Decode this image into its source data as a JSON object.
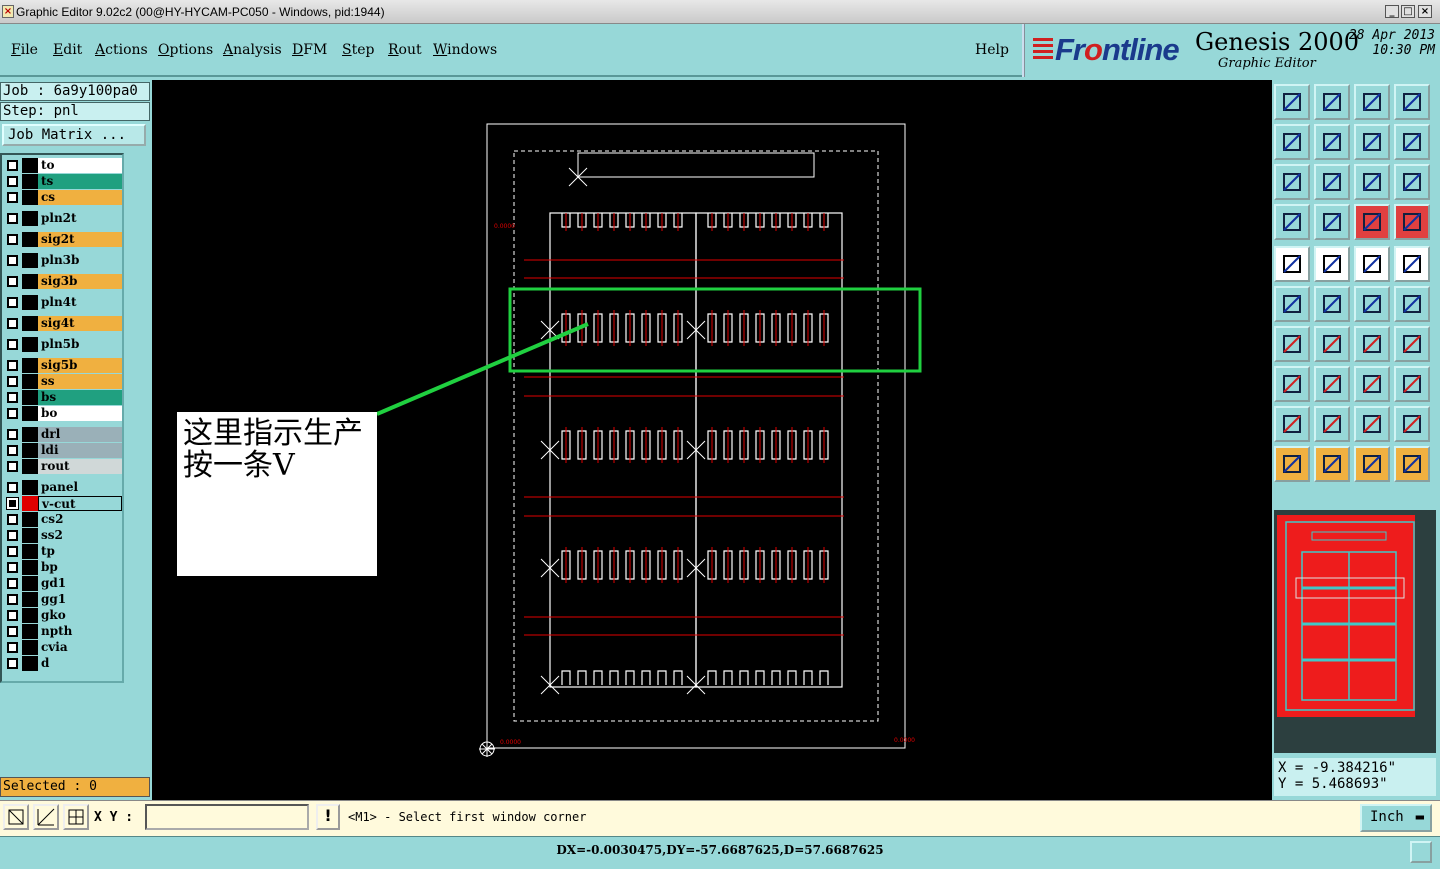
{
  "window": {
    "title": "Graphic Editor 9.02c2 (00@HY-HYCAM-PC050 - Windows, pid:1944)",
    "app_icon": "x-icon",
    "controls": [
      "minimize",
      "maximize",
      "close"
    ]
  },
  "menu": {
    "items": [
      {
        "label": "File",
        "accent": "F"
      },
      {
        "label": "Edit",
        "accent": "E"
      },
      {
        "label": "Actions",
        "accent": "A"
      },
      {
        "label": "Options",
        "accent": "O"
      },
      {
        "label": "Analysis",
        "accent": "A"
      },
      {
        "label": "DFM",
        "accent": "D"
      },
      {
        "label": "Step",
        "accent": "S"
      },
      {
        "label": "Rout",
        "accent": "R"
      },
      {
        "label": "Windows",
        "accent": "W"
      }
    ],
    "help": "Help"
  },
  "branding": {
    "logo_text_a": "Fr",
    "logo_text_o": "o",
    "logo_text_b": "ntline",
    "product": "Genesis 2000",
    "subtitle": "Graphic Editor",
    "date": "28 Apr 2013",
    "time": "10:30 PM",
    "logo_color": "#1a3a8c",
    "logo_accent": "#d02020"
  },
  "left": {
    "job": "Job : 6a9y100pa0",
    "step": "Step: pnl",
    "job_matrix": "Job Matrix ...",
    "selected": "Selected : 0",
    "layers": [
      {
        "name": "to",
        "color": "#ffffff"
      },
      {
        "name": "ts",
        "color": "#20a080"
      },
      {
        "name": "cs",
        "color": "#f0b040"
      },
      {
        "name": "pln2t",
        "color": "#97d8d8"
      },
      {
        "name": "sig2t",
        "color": "#f0b040"
      },
      {
        "name": "pln3b",
        "color": "#97d8d8"
      },
      {
        "name": "sig3b",
        "color": "#f0b040"
      },
      {
        "name": "pln4t",
        "color": "#97d8d8"
      },
      {
        "name": "sig4t",
        "color": "#f0b040"
      },
      {
        "name": "pln5b",
        "color": "#97d8d8"
      },
      {
        "name": "sig5b",
        "color": "#f0b040"
      },
      {
        "name": "ss",
        "color": "#f0b040"
      },
      {
        "name": "bs",
        "color": "#20a080"
      },
      {
        "name": "bo",
        "color": "#ffffff"
      },
      {
        "name": "drl",
        "color": "#9ab0b8"
      },
      {
        "name": "ldi",
        "color": "#9ab0b8"
      },
      {
        "name": "rout",
        "color": "#d0d8d8"
      },
      {
        "name": "panel",
        "color": "#97d8d8"
      },
      {
        "name": "v-cut",
        "color": "#97d8d8",
        "active": true,
        "swatch": "#e00000"
      },
      {
        "name": "cs2",
        "color": "#97d8d8"
      },
      {
        "name": "ss2",
        "color": "#97d8d8"
      },
      {
        "name": "tp",
        "color": "#97d8d8"
      },
      {
        "name": "bp",
        "color": "#97d8d8"
      },
      {
        "name": "gd1",
        "color": "#97d8d8"
      },
      {
        "name": "gg1",
        "color": "#97d8d8"
      },
      {
        "name": "gko",
        "color": "#97d8d8"
      },
      {
        "name": "npth",
        "color": "#97d8d8"
      },
      {
        "name": "cvia",
        "color": "#97d8d8"
      },
      {
        "name": "d",
        "color": "#97d8d8"
      }
    ]
  },
  "canvas": {
    "annotation": "这里指示生产按一条V",
    "highlight_color": "#20d040",
    "vcut_color": "#e00000"
  },
  "coords": {
    "x": "X = -9.384216\"",
    "y": "Y = 5.468693\""
  },
  "bottom": {
    "xy_label": "X Y :",
    "xy_value": "",
    "prompt": "<M1> - Select first window corner",
    "units": "Inch",
    "status": "DX=-0.0030475,DY=-57.6687625,D=57.6687625"
  }
}
